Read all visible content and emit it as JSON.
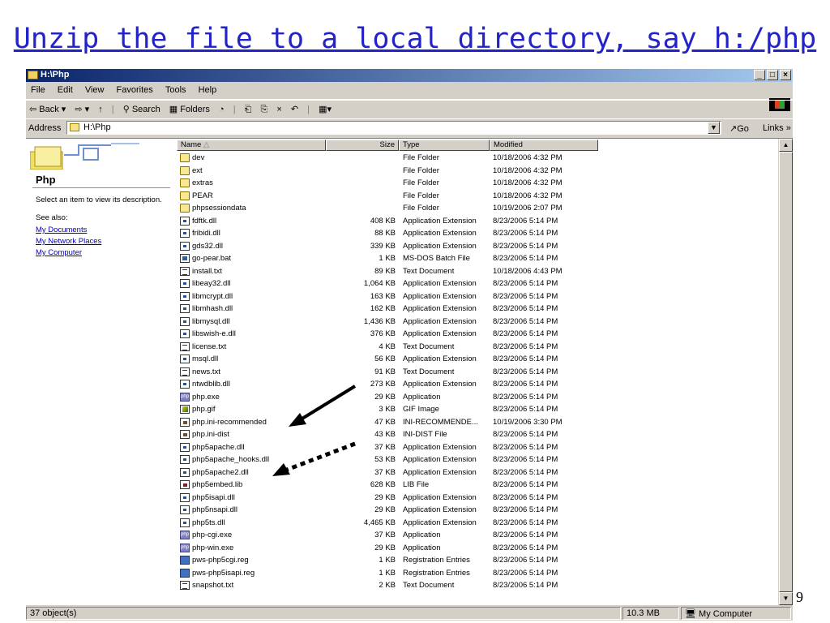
{
  "slide": {
    "title": "Unzip the file to a local directory, say h:/php",
    "page_number": "9"
  },
  "window": {
    "title": "H:\\Php",
    "controls": [
      "_",
      "□",
      "×"
    ]
  },
  "menu": [
    {
      "label": "File"
    },
    {
      "label": "Edit"
    },
    {
      "label": "View"
    },
    {
      "label": "Favorites"
    },
    {
      "label": "Tools"
    },
    {
      "label": "Help"
    }
  ],
  "toolbar": {
    "back": "⇦ Back ▾",
    "forward": "⇨ ▾",
    "up": "↑",
    "search": "Search",
    "folders": "Folders",
    "history": "◔",
    "move": "⎗",
    "copy": "⎘",
    "delete": "×",
    "undo": "↶",
    "views": "▦▾"
  },
  "address": {
    "label": "Address",
    "value": "H:\\Php",
    "go": "Go",
    "links": "Links »"
  },
  "left_pane": {
    "title": "Php",
    "description": "Select an item to view its description.",
    "see_also": "See also:",
    "links": [
      "My Documents",
      "My Network Places",
      "My Computer"
    ]
  },
  "columns": [
    "Name",
    "Size",
    "Type",
    "Modified"
  ],
  "files": [
    {
      "name": "dev",
      "size": "",
      "type": "File Folder",
      "modified": "10/18/2006 4:32 PM",
      "icon": "folder"
    },
    {
      "name": "ext",
      "size": "",
      "type": "File Folder",
      "modified": "10/18/2006 4:32 PM",
      "icon": "folder"
    },
    {
      "name": "extras",
      "size": "",
      "type": "File Folder",
      "modified": "10/18/2006 4:32 PM",
      "icon": "folder"
    },
    {
      "name": "PEAR",
      "size": "",
      "type": "File Folder",
      "modified": "10/18/2006 4:32 PM",
      "icon": "folder"
    },
    {
      "name": "phpsessiondata",
      "size": "",
      "type": "File Folder",
      "modified": "10/19/2006 2:07 PM",
      "icon": "folder"
    },
    {
      "name": "fdftk.dll",
      "size": "408 KB",
      "type": "Application Extension",
      "modified": "8/23/2006 5:14 PM",
      "icon": "dll"
    },
    {
      "name": "fribidi.dll",
      "size": "88 KB",
      "type": "Application Extension",
      "modified": "8/23/2006 5:14 PM",
      "icon": "dll"
    },
    {
      "name": "gds32.dll",
      "size": "339 KB",
      "type": "Application Extension",
      "modified": "8/23/2006 5:14 PM",
      "icon": "dll"
    },
    {
      "name": "go-pear.bat",
      "size": "1 KB",
      "type": "MS-DOS Batch File",
      "modified": "8/23/2006 5:14 PM",
      "icon": "bat"
    },
    {
      "name": "install.txt",
      "size": "89 KB",
      "type": "Text Document",
      "modified": "10/18/2006 4:43 PM",
      "icon": "txt"
    },
    {
      "name": "libeay32.dll",
      "size": "1,064 KB",
      "type": "Application Extension",
      "modified": "8/23/2006 5:14 PM",
      "icon": "dll"
    },
    {
      "name": "libmcrypt.dll",
      "size": "163 KB",
      "type": "Application Extension",
      "modified": "8/23/2006 5:14 PM",
      "icon": "dll"
    },
    {
      "name": "libmhash.dll",
      "size": "162 KB",
      "type": "Application Extension",
      "modified": "8/23/2006 5:14 PM",
      "icon": "dll"
    },
    {
      "name": "libmysql.dll",
      "size": "1,436 KB",
      "type": "Application Extension",
      "modified": "8/23/2006 5:14 PM",
      "icon": "dll"
    },
    {
      "name": "libswish-e.dll",
      "size": "376 KB",
      "type": "Application Extension",
      "modified": "8/23/2006 5:14 PM",
      "icon": "dll"
    },
    {
      "name": "license.txt",
      "size": "4 KB",
      "type": "Text Document",
      "modified": "8/23/2006 5:14 PM",
      "icon": "txt"
    },
    {
      "name": "msql.dll",
      "size": "56 KB",
      "type": "Application Extension",
      "modified": "8/23/2006 5:14 PM",
      "icon": "dll"
    },
    {
      "name": "news.txt",
      "size": "91 KB",
      "type": "Text Document",
      "modified": "8/23/2006 5:14 PM",
      "icon": "txt"
    },
    {
      "name": "ntwdblib.dll",
      "size": "273 KB",
      "type": "Application Extension",
      "modified": "8/23/2006 5:14 PM",
      "icon": "dll"
    },
    {
      "name": "php.exe",
      "size": "29 KB",
      "type": "Application",
      "modified": "8/23/2006 5:14 PM",
      "icon": "exe"
    },
    {
      "name": "php.gif",
      "size": "3 KB",
      "type": "GIF Image",
      "modified": "8/23/2006 5:14 PM",
      "icon": "gif"
    },
    {
      "name": "php.ini-recommended",
      "size": "47 KB",
      "type": "INI-RECOMMENDE...",
      "modified": "10/19/2006 3:30 PM",
      "icon": "ini"
    },
    {
      "name": "php.ini-dist",
      "size": "43 KB",
      "type": "INI-DIST File",
      "modified": "8/23/2006 5:14 PM",
      "icon": "ini"
    },
    {
      "name": "php5apache.dll",
      "size": "37 KB",
      "type": "Application Extension",
      "modified": "8/23/2006 5:14 PM",
      "icon": "dll"
    },
    {
      "name": "php5apache_hooks.dll",
      "size": "53 KB",
      "type": "Application Extension",
      "modified": "8/23/2006 5:14 PM",
      "icon": "dll"
    },
    {
      "name": "php5apache2.dll",
      "size": "37 KB",
      "type": "Application Extension",
      "modified": "8/23/2006 5:14 PM",
      "icon": "dll"
    },
    {
      "name": "php5embed.lib",
      "size": "628 KB",
      "type": "LIB File",
      "modified": "8/23/2006 5:14 PM",
      "icon": "lib"
    },
    {
      "name": "php5isapi.dll",
      "size": "29 KB",
      "type": "Application Extension",
      "modified": "8/23/2006 5:14 PM",
      "icon": "dll"
    },
    {
      "name": "php5nsapi.dll",
      "size": "29 KB",
      "type": "Application Extension",
      "modified": "8/23/2006 5:14 PM",
      "icon": "dll"
    },
    {
      "name": "php5ts.dll",
      "size": "4,465 KB",
      "type": "Application Extension",
      "modified": "8/23/2006 5:14 PM",
      "icon": "dll"
    },
    {
      "name": "php-cgi.exe",
      "size": "37 KB",
      "type": "Application",
      "modified": "8/23/2006 5:14 PM",
      "icon": "exe"
    },
    {
      "name": "php-win.exe",
      "size": "29 KB",
      "type": "Application",
      "modified": "8/23/2006 5:14 PM",
      "icon": "exe"
    },
    {
      "name": "pws-php5cgi.reg",
      "size": "1 KB",
      "type": "Registration Entries",
      "modified": "8/23/2006 5:14 PM",
      "icon": "reg"
    },
    {
      "name": "pws-php5isapi.reg",
      "size": "1 KB",
      "type": "Registration Entries",
      "modified": "8/23/2006 5:14 PM",
      "icon": "reg"
    },
    {
      "name": "snapshot.txt",
      "size": "2 KB",
      "type": "Text Document",
      "modified": "8/23/2006 5:14 PM",
      "icon": "txt"
    }
  ],
  "status": {
    "objects": "37 object(s)",
    "size": "10.3 MB",
    "zone": "My Computer"
  }
}
